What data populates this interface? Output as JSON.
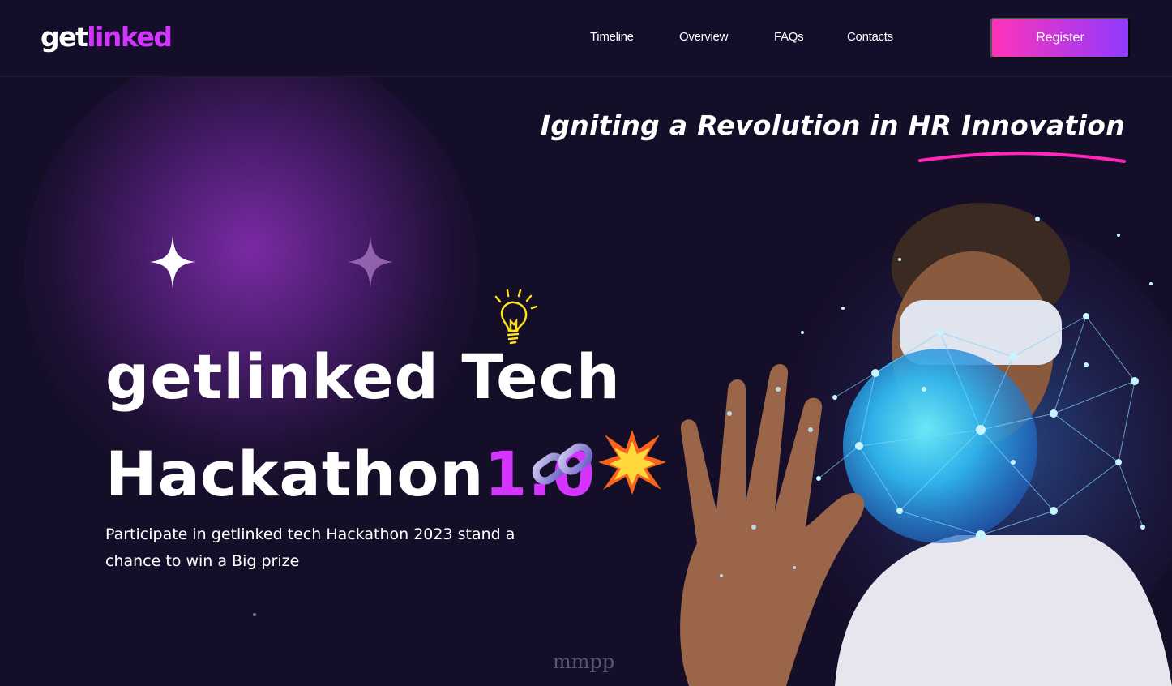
{
  "navbar": {
    "logo": {
      "part1": "get",
      "part2": "linked"
    },
    "links": [
      {
        "label": "Timeline"
      },
      {
        "label": "Overview"
      },
      {
        "label": "FAQs"
      },
      {
        "label": "Contacts"
      }
    ],
    "register_label": "Register"
  },
  "hero": {
    "tagline": "Igniting a Revolution in HR Innovation",
    "title_line1": "getlinked Tech",
    "title_line2_main": "Hackathon",
    "title_line2_accent": "1.0",
    "description": "Participate in getlinked tech Hackathon 2023 stand a chance to win a Big prize",
    "watermark": "mmpp"
  },
  "colors": {
    "background": "#150e28",
    "accent": "#d434fe",
    "underline": "#ff26b9",
    "button_start": "#fe34b9",
    "button_end": "#903aff"
  },
  "icons": [
    "sparkle-icon",
    "lightbulb-icon",
    "chain-link-icon",
    "explosion-icon"
  ]
}
